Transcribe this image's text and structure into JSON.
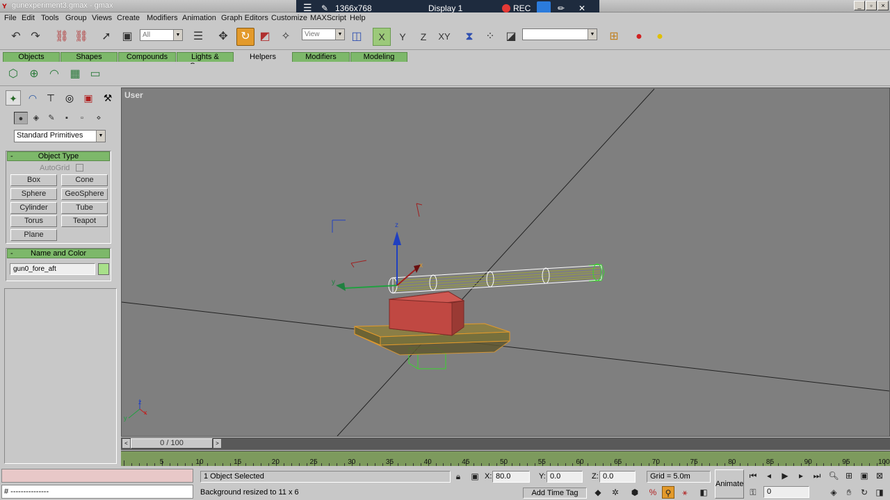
{
  "window": {
    "title": "gunexperiment3.gmax - gmax",
    "controls": [
      "_",
      "▫",
      "×"
    ]
  },
  "overlay": {
    "resolution": "1366x768",
    "display": "Display 1",
    "rec_label": "REC"
  },
  "menu": [
    "File",
    "Edit",
    "Tools",
    "Group",
    "Views",
    "Create",
    "Modifiers",
    "Animation",
    "Graph Editors",
    "Customize",
    "MAXScript",
    "Help"
  ],
  "toolbar": {
    "selection_filter": "All",
    "reference_coord": "View",
    "axis_x": "X",
    "axis_y": "Y",
    "axis_z": "Z",
    "axis_xy": "XY",
    "named_selection": ""
  },
  "tabs": [
    "Objects",
    "Shapes",
    "Compounds",
    "Lights & Cameras",
    "Helpers",
    "Modifiers",
    "Modeling"
  ],
  "active_tab": "Helpers",
  "command_panel": {
    "primitive_list": "Standard Primitives",
    "object_type": {
      "header": "Object Type",
      "autogrid_label": "AutoGrid",
      "buttons": [
        "Box",
        "Cone",
        "Sphere",
        "GeoSphere",
        "Cylinder",
        "Tube",
        "Torus",
        "Teapot",
        "Plane"
      ]
    },
    "name_and_color": {
      "header": "Name and Color",
      "object_name": "gun0_fore_aft",
      "color": "#a8e08a"
    }
  },
  "viewport": {
    "label": "User",
    "gizmo_labels": {
      "z": "z",
      "y": "y",
      "x": "x"
    }
  },
  "timeline": {
    "slider": "0 / 100",
    "ticks": [
      "5",
      "10",
      "15",
      "20",
      "25",
      "30",
      "35",
      "40",
      "45",
      "50",
      "55",
      "60",
      "65",
      "70",
      "75",
      "80",
      "85",
      "90",
      "95",
      "100"
    ]
  },
  "status": {
    "listener_line": "# ---------------",
    "selection": "1 Object Selected",
    "prompt": "Background resized to 11 x 6",
    "x_label": "X:",
    "x_value": "80.0",
    "y_label": "Y:",
    "y_value": "0.0",
    "z_label": "Z:",
    "z_value": "0.0",
    "grid": "Grid = 5.0m",
    "add_time_tag": "Add Time Tag",
    "animate": "Animate",
    "frame": "0"
  },
  "colors": {
    "viewport_bg": "#7f7f7f",
    "tab_green": "#7db86a",
    "active_orange": "#e39a2b",
    "box_red": "#c8504a",
    "base_olive": "#7a7040",
    "track_green": "#7d9a5d"
  }
}
